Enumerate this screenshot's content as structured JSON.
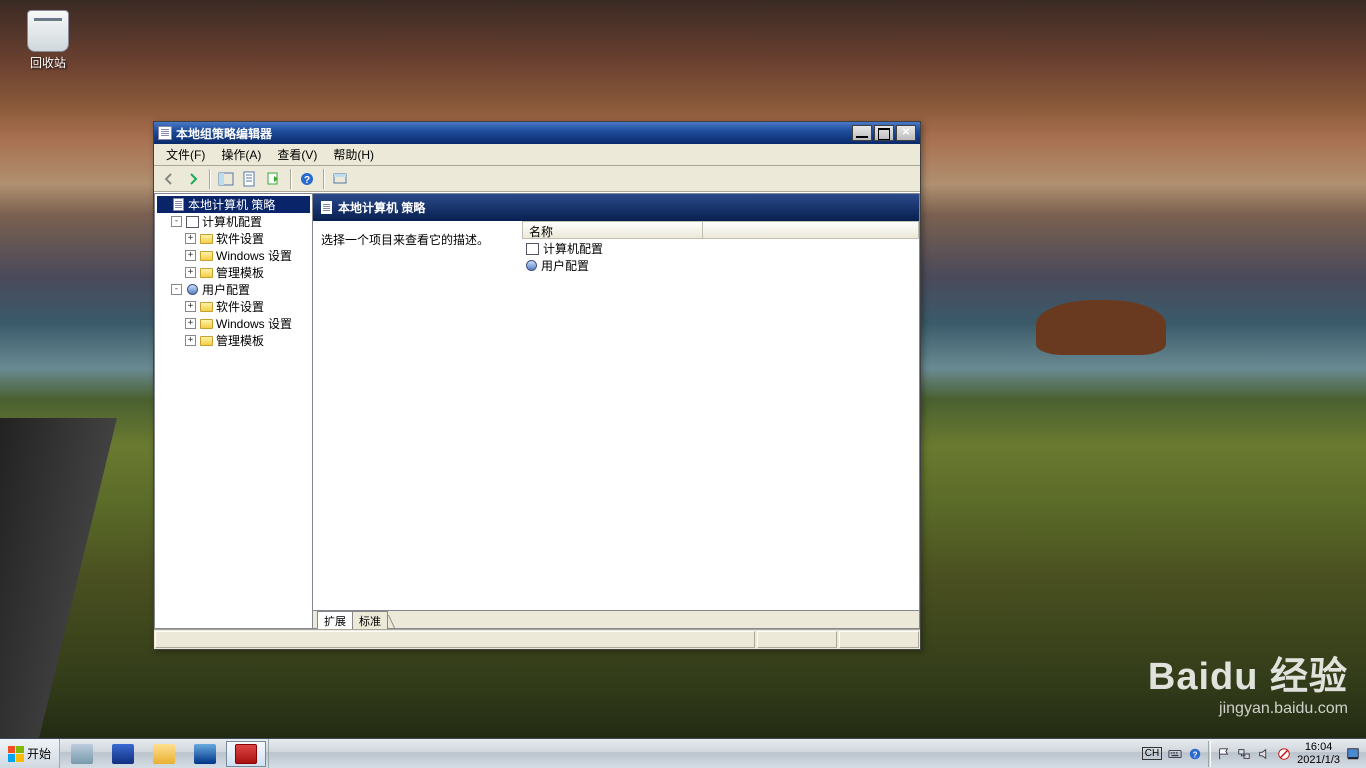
{
  "desktop": {
    "recycle_bin": "回收站"
  },
  "watermark": {
    "brand": "Baidu 经验",
    "url": "jingyan.baidu.com"
  },
  "window": {
    "title": "本地组策略编辑器",
    "menu": {
      "file": "文件(F)",
      "action": "操作(A)",
      "view": "查看(V)",
      "help": "帮助(H)"
    },
    "tree": {
      "root": "本地计算机 策略",
      "computer_config": "计算机配置",
      "software_settings": "软件设置",
      "windows_settings": "Windows 设置",
      "admin_templates": "管理模板",
      "user_config": "用户配置"
    },
    "right": {
      "header": "本地计算机 策略",
      "description_prompt": "选择一个项目来查看它的描述。",
      "column_name": "名称",
      "items": {
        "computer_config": "计算机配置",
        "user_config": "用户配置"
      },
      "tab_extended": "扩展",
      "tab_standard": "标准"
    }
  },
  "taskbar": {
    "start": "开始",
    "ime_lang": "CH",
    "time": "16:04",
    "date": "2021/1/3"
  }
}
